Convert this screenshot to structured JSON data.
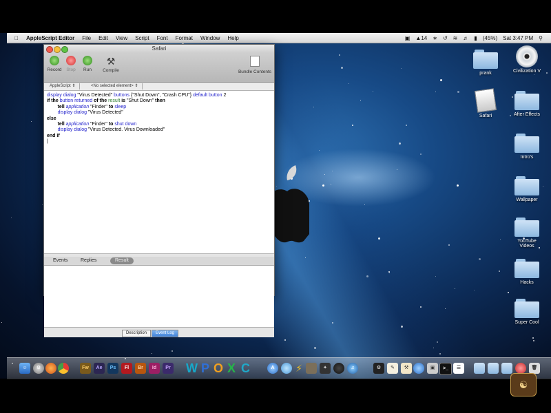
{
  "menubar": {
    "app_name": "AppleScript Editor",
    "menus": [
      "File",
      "Edit",
      "View",
      "Script",
      "Font",
      "Format",
      "Window",
      "Help"
    ],
    "status": {
      "battery_text": "(45%)",
      "clock": "Sat 3:47 PM",
      "badge_count": "14"
    }
  },
  "window": {
    "title": "Safari",
    "toolbar": {
      "record": "Record",
      "stop": "Stop",
      "run": "Run",
      "compile": "Compile",
      "bundle_contents": "Bundle Contents"
    },
    "navbar": {
      "language": "AppleScript",
      "element": "<No selected element>"
    },
    "code_lines": [
      "display dialog \"Virus Detected\" buttons {\"Shut Down\", \"Crash CPU\"} default button 2",
      "if the button returned of the result is \"Shut Down\" then",
      "tell application \"Finder\" to sleep",
      "display dialog \"Virus Detected\"",
      "else",
      "tell application \"Finder\" to shut down",
      "display dialog \"Virus Detected. Virus Downloaded\"",
      "end if"
    ],
    "tabs": [
      "Events",
      "Replies",
      "Result"
    ],
    "bottom_tabs": [
      "Description",
      "Event Log"
    ]
  },
  "desktop_icons": [
    {
      "label": "prank",
      "kind": "folder"
    },
    {
      "label": "Civilization V",
      "kind": "cd"
    },
    {
      "label": "Safari",
      "kind": "file"
    },
    {
      "label": "After Effects",
      "kind": "folder"
    },
    {
      "label": "Intro's",
      "kind": "folder"
    },
    {
      "label": "Wallpaper",
      "kind": "folder"
    },
    {
      "label": "YouTube Videos",
      "kind": "folder"
    },
    {
      "label": "Hacks",
      "kind": "folder"
    },
    {
      "label": "Super Cool",
      "kind": "folder"
    }
  ],
  "dock": {
    "adobe_apps": [
      "Fw",
      "Ae",
      "Ps",
      "Fl",
      "Br",
      "Id",
      "Pr"
    ],
    "letters": [
      "W",
      "P",
      "O",
      "X",
      "C"
    ]
  },
  "colors": {
    "keyword": "#000000",
    "application": "#2222cc",
    "command": "#2222cc",
    "variable": "#2e7d32",
    "selected_segment": "#3f81d8"
  }
}
